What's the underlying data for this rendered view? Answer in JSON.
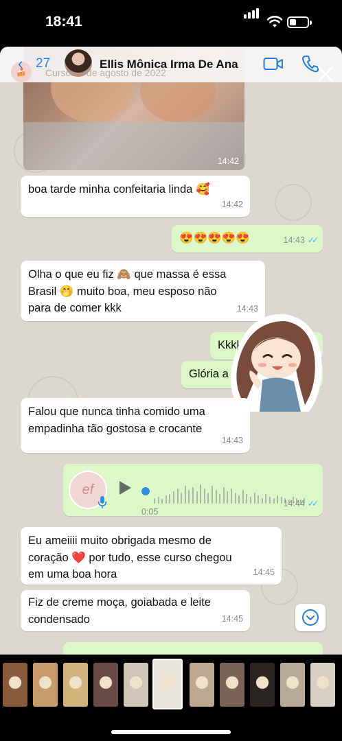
{
  "status_bar": {
    "time": "18:41"
  },
  "header": {
    "back_count": "27",
    "contact_name": "Ellis Mônica Irma De Ana",
    "ghost_title": "Cursos",
    "ghost_date": "3 de agosto de 2022"
  },
  "messages": {
    "photo_time": "14:42",
    "m1_text": "boa tarde minha confeitaria linda 🥰",
    "m1_time": "14:42",
    "m2_text": "😍😍😍😍😍",
    "m2_time": "14:43",
    "m3_line1": "Olha o que eu fiz 🙈 que massa é essa",
    "m3_line2": "Brasil 🤭 muito boa, meu esposo não",
    "m3_line3": "para de comer kkk",
    "m3_time": "14:43",
    "m4_text": "Kkkkk",
    "m5_text": "Glória a",
    "m6_line1": "Falou que nunca tinha comido uma",
    "m6_line2": "empadinha tão gostosa e crocante",
    "m6_time": "14:43",
    "voice_duration": "0:05",
    "voice_time": "14:44",
    "m7_line1": "Eu ameiiii muito obrigada mesmo de",
    "m7_line2": "coração ❤️ por tudo, esse curso chegou",
    "m7_line3": "em uma boa hora",
    "m7_time": "14:45",
    "m8_line1": "Fiz de creme moça, goiabada e leite",
    "m8_line2": "condensado",
    "m8_time": "14:45",
    "voice_avatar_text": "ef"
  },
  "colors": {
    "incoming": "#ffffff",
    "outgoing": "#dcf8c6",
    "accent": "#1f7cf0",
    "read_ticks": "#4fb6ec"
  },
  "icons": [
    "back-chevron-icon",
    "video-call-icon",
    "phone-icon",
    "close-icon",
    "play-icon",
    "mic-icon",
    "scroll-down-icon",
    "signal-icon",
    "wifi-icon",
    "battery-icon"
  ]
}
